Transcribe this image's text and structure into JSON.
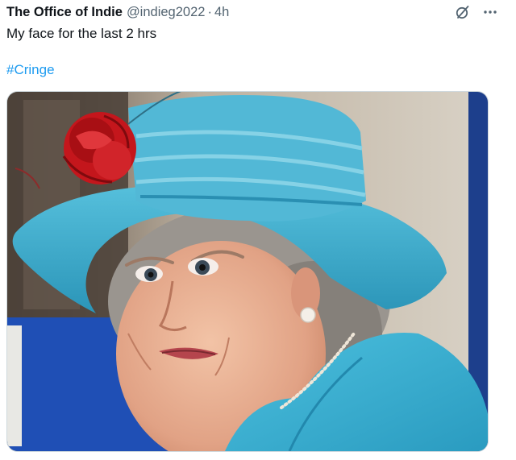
{
  "tweet": {
    "author_name": "The Office of Indie",
    "author_handle": "@indieg2022",
    "separator": "·",
    "time": "4h",
    "text": "My face for the last 2 hrs",
    "hashtag": "#Cringe"
  },
  "icons": {
    "grok": "grok-slash-circle-icon",
    "more": "more-horizontal-icon"
  },
  "colors": {
    "link": "#1d9bf0",
    "secondary_text": "#536471",
    "primary_text": "#0f1419",
    "hat_teal": "#39a9c9",
    "rose_red": "#c4161c",
    "backdrop_blue": "#1f4fb5"
  }
}
